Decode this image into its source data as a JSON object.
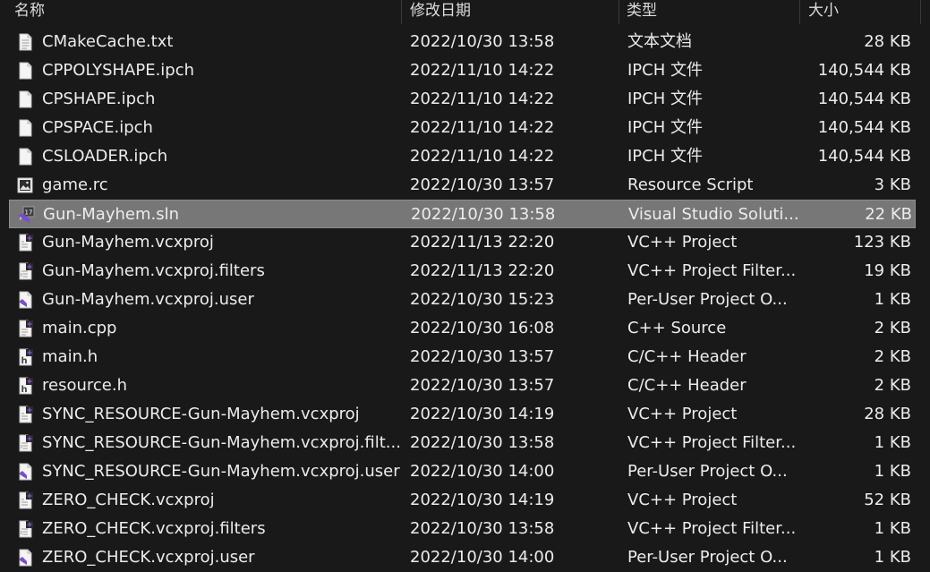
{
  "columns": {
    "name": "名称",
    "date": "修改日期",
    "type": "类型",
    "size": "大小"
  },
  "files": [
    {
      "name": "CMakeCache.txt",
      "date": "2022/10/30 13:58",
      "type": "文本文档",
      "size": "28 KB",
      "icon": "text-file-icon"
    },
    {
      "name": "CPPOLYSHAPE.ipch",
      "date": "2022/11/10 14:22",
      "type": "IPCH 文件",
      "size": "140,544 KB",
      "icon": "blank-file-icon"
    },
    {
      "name": "CPSHAPE.ipch",
      "date": "2022/11/10 14:22",
      "type": "IPCH 文件",
      "size": "140,544 KB",
      "icon": "blank-file-icon"
    },
    {
      "name": "CPSPACE.ipch",
      "date": "2022/11/10 14:22",
      "type": "IPCH 文件",
      "size": "140,544 KB",
      "icon": "blank-file-icon"
    },
    {
      "name": "CSLOADER.ipch",
      "date": "2022/11/10 14:22",
      "type": "IPCH 文件",
      "size": "140,544 KB",
      "icon": "blank-file-icon"
    },
    {
      "name": "game.rc",
      "date": "2022/10/30 13:57",
      "type": "Resource Script",
      "size": "3 KB",
      "icon": "image-file-icon"
    },
    {
      "name": "Gun-Mayhem.sln",
      "date": "2022/10/30 13:58",
      "type": "Visual Studio Soluti...",
      "size": "22 KB",
      "icon": "visual-studio-solution-icon",
      "selected": true
    },
    {
      "name": "Gun-Mayhem.vcxproj",
      "date": "2022/11/13 22:20",
      "type": "VC++ Project",
      "size": "123 KB",
      "icon": "vcxproj-file-icon"
    },
    {
      "name": "Gun-Mayhem.vcxproj.filters",
      "date": "2022/11/13 22:20",
      "type": "VC++ Project Filter...",
      "size": "19 KB",
      "icon": "filters-file-icon"
    },
    {
      "name": "Gun-Mayhem.vcxproj.user",
      "date": "2022/10/30 15:23",
      "type": "Per-User Project O...",
      "size": "1 KB",
      "icon": "user-project-file-icon"
    },
    {
      "name": "main.cpp",
      "date": "2022/10/30 16:08",
      "type": "C++ Source",
      "size": "2 KB",
      "icon": "cpp-file-icon"
    },
    {
      "name": "main.h",
      "date": "2022/10/30 13:57",
      "type": "C/C++ Header",
      "size": "2 KB",
      "icon": "header-file-icon"
    },
    {
      "name": "resource.h",
      "date": "2022/10/30 13:57",
      "type": "C/C++ Header",
      "size": "2 KB",
      "icon": "header-file-icon"
    },
    {
      "name": "SYNC_RESOURCE-Gun-Mayhem.vcxproj",
      "date": "2022/10/30 14:19",
      "type": "VC++ Project",
      "size": "28 KB",
      "icon": "vcxproj-file-icon"
    },
    {
      "name": "SYNC_RESOURCE-Gun-Mayhem.vcxproj.filt...",
      "date": "2022/10/30 13:58",
      "type": "VC++ Project Filter...",
      "size": "1 KB",
      "icon": "filters-file-icon"
    },
    {
      "name": "SYNC_RESOURCE-Gun-Mayhem.vcxproj.user",
      "date": "2022/10/30 14:00",
      "type": "Per-User Project O...",
      "size": "1 KB",
      "icon": "user-project-file-icon"
    },
    {
      "name": "ZERO_CHECK.vcxproj",
      "date": "2022/10/30 14:19",
      "type": "VC++ Project",
      "size": "52 KB",
      "icon": "vcxproj-file-icon"
    },
    {
      "name": "ZERO_CHECK.vcxproj.filters",
      "date": "2022/10/30 13:58",
      "type": "VC++ Project Filter...",
      "size": "1 KB",
      "icon": "filters-file-icon"
    },
    {
      "name": "ZERO_CHECK.vcxproj.user",
      "date": "2022/10/30 14:00",
      "type": "Per-User Project O...",
      "size": "1 KB",
      "icon": "user-project-file-icon"
    }
  ],
  "colors": {
    "background": "#191919",
    "selection": "#777777",
    "vs_purple": "#7a4fc4"
  }
}
